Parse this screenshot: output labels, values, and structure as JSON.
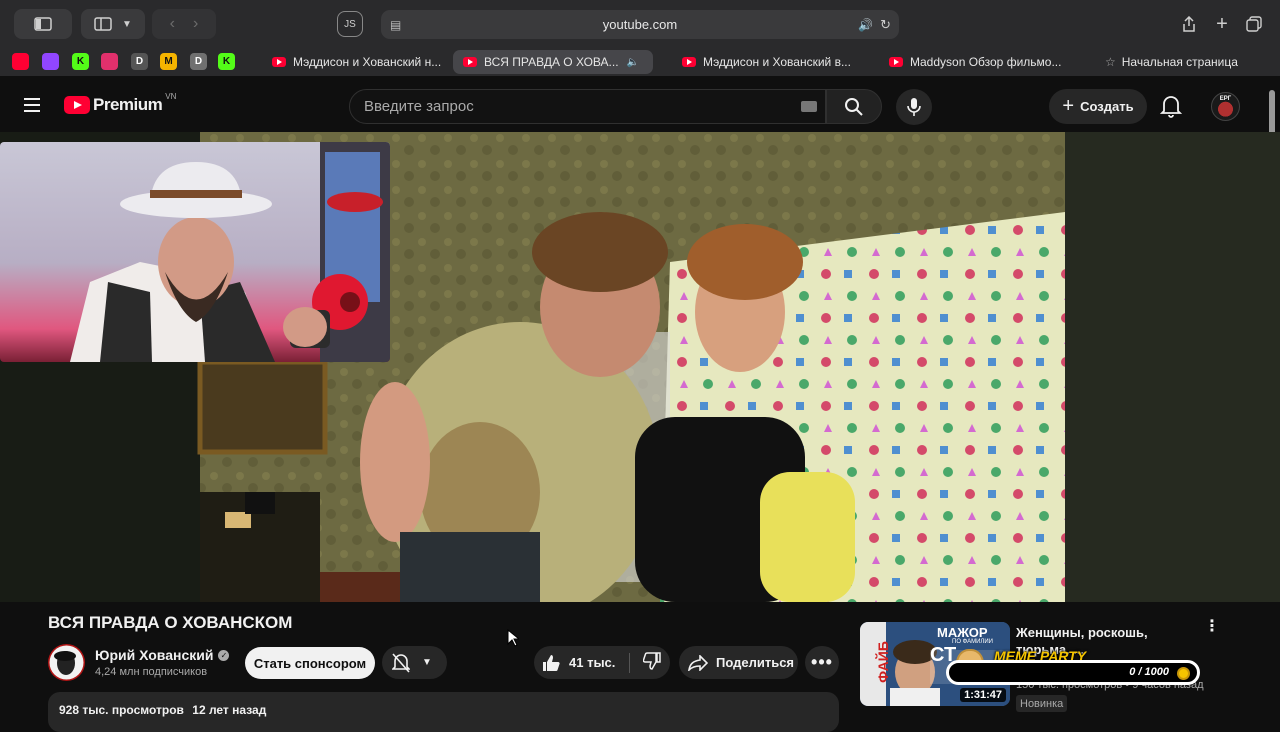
{
  "browser": {
    "url": "youtube.com",
    "favorites": [
      {
        "icon": "youtube-icon",
        "color": "#ff0033",
        "label": ""
      },
      {
        "icon": "twitch-icon",
        "color": "#9146ff",
        "label": ""
      },
      {
        "icon": "kick-icon",
        "color": "#53fc18",
        "label": "K"
      },
      {
        "icon": "instagram-icon",
        "color": "#e1306c",
        "label": ""
      },
      {
        "icon": "dl-icon",
        "color": "#555555",
        "label": "D"
      },
      {
        "icon": "m-icon",
        "color": "#f5b400",
        "label": "M"
      },
      {
        "icon": "d-icon",
        "color": "#707070",
        "label": "D"
      },
      {
        "icon": "kick-icon-2",
        "color": "#53fc18",
        "label": "K"
      }
    ],
    "tabs": [
      {
        "label": "Мэддисон и Хованский н...",
        "active": false
      },
      {
        "label": "ВСЯ ПРАВДА О ХОВА...",
        "active": true
      },
      {
        "label": "Мэддисон и Хованский в...",
        "active": false
      },
      {
        "label": "Maddyson Обзор фильмо...",
        "active": false
      },
      {
        "label": "Начальная страница",
        "active": false
      }
    ]
  },
  "header": {
    "logo_text": "Premium",
    "region": "VN",
    "search_placeholder": "Введите запрос",
    "create_label": "Создать",
    "avatar_text": "ЕРГ"
  },
  "video": {
    "title": "ВСЯ ПРАВДА О ХОВАНСКОМ",
    "channel_name": "Юрий Хованский",
    "subscribers": "4,24 млн подписчиков",
    "sponsor_label": "Стать спонсором",
    "likes": "41 тыс.",
    "share_label": "Поделиться",
    "views": "928 тыс. просмотров",
    "posted": "12 лет назад"
  },
  "related": {
    "title": "Женщины, роскошь, тюрьма. ...",
    "duration": "1:31:47",
    "meta_views": "150 тыс. просмотров",
    "meta_time": "9 часов назад",
    "badge": "Новинка",
    "thumb_text_top": "МАЖОР",
    "thumb_text_sub": "ПО ФАМИЛИИ",
    "thumb_text_side": "ФАЙБ",
    "thumb_text_main": "СТ"
  },
  "overlay": {
    "title": "MEME PARTY",
    "progress": "0 / 1000",
    "progress_value": 0
  }
}
